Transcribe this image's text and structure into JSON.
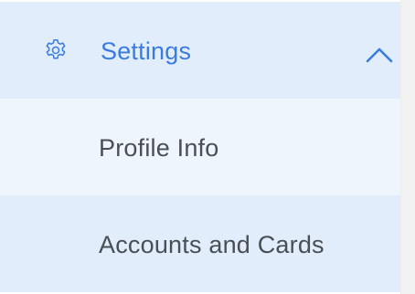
{
  "menu": {
    "settings": {
      "label": "Settings",
      "icon": "gear-icon",
      "toggle_icon": "chevron-up-icon",
      "expanded": true
    },
    "items": [
      {
        "label": "Profile Info"
      },
      {
        "label": "Accounts and Cards"
      }
    ]
  },
  "colors": {
    "accent": "#3a7be0",
    "header_bg": "#e1edfb",
    "item_alt_bg": "#eef5fd",
    "item_text": "#4a4e55"
  }
}
